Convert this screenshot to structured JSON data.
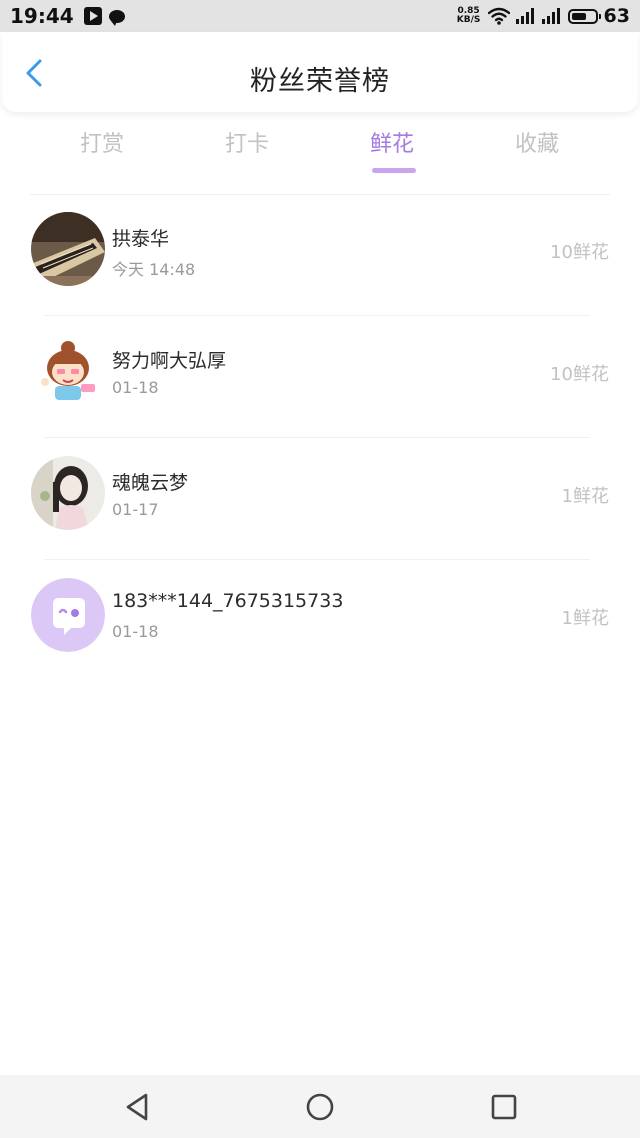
{
  "status_bar": {
    "time": "19:44",
    "net_speed_value": "0.85",
    "net_speed_unit": "KB/S",
    "battery_level": 63,
    "battery_text": "63",
    "icons": [
      "play-icon",
      "chat-icon",
      "wifi-icon",
      "signal-icon",
      "signal-icon",
      "battery-icon"
    ]
  },
  "header": {
    "title": "粉丝荣誉榜",
    "back_icon": "chevron-left-icon",
    "accent_color": "#3a99ee"
  },
  "tabs": {
    "items": [
      {
        "label": "打赏"
      },
      {
        "label": "打卡"
      },
      {
        "label": "鲜花"
      },
      {
        "label": "收藏"
      }
    ],
    "active": "鲜花",
    "active_color": "#a47be0"
  },
  "fans": [
    {
      "name": "拱泰华",
      "date": "今天 14:48",
      "count": "10鲜花"
    },
    {
      "name": "努力啊大弘厚",
      "date": "01-18",
      "count": "10鲜花"
    },
    {
      "name": "魂魄云梦",
      "date": "01-17",
      "count": "1鲜花"
    },
    {
      "name": "183***144_7675315733",
      "date": "01-18",
      "count": "1鲜花"
    }
  ],
  "nav_bar": {
    "icons": [
      "back-triangle-icon",
      "home-circle-icon",
      "recents-square-icon"
    ]
  }
}
